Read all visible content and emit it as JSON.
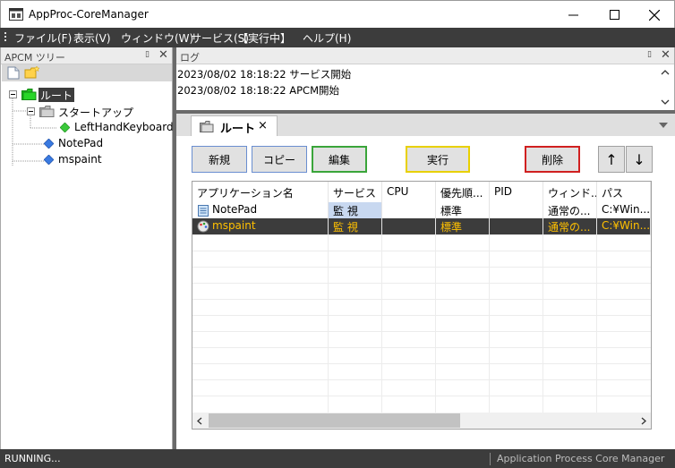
{
  "window": {
    "title": "AppProc-CoreManager",
    "minimize_glyph": "—",
    "maximize_glyph": "☐",
    "close_glyph": "✕"
  },
  "menu": {
    "items": [
      {
        "label": "ファイル(F)"
      },
      {
        "label": "表示(V)"
      },
      {
        "label": "ウィンドウ(W)"
      },
      {
        "label": "サービス(S)"
      },
      {
        "label": "【実行中】"
      },
      {
        "label": "ヘルプ(H)"
      }
    ]
  },
  "tree_panel": {
    "title": "APCM ツリー",
    "pin_glyph": "▯",
    "close_glyph": "✕",
    "nodes": [
      {
        "label": "ルート",
        "selected": true
      },
      {
        "label": "スタートアップ"
      },
      {
        "label": "LeftHandKeyboard"
      },
      {
        "label": "NotePad"
      },
      {
        "label": "mspaint"
      }
    ]
  },
  "log_panel": {
    "title": "ログ",
    "lines": [
      "2023/08/02 18:18:22 サービス開始",
      "2023/08/02 18:18:22 APCM開始"
    ]
  },
  "document": {
    "tab_label": "ルート",
    "tab_close": "×",
    "buttons": {
      "new": "新規",
      "copy": "コピー",
      "edit": "編集",
      "run": "実行",
      "delete": "削除",
      "up": "↑",
      "down": "↓"
    },
    "grid": {
      "columns": [
        "アプリケーション名",
        "サービス",
        "CPU",
        "優先順...",
        "PID",
        "ウィンド...",
        "パス"
      ],
      "rows": [
        {
          "name": "NotePad",
          "service": "監 視",
          "cpu": "",
          "priority": "標準",
          "pid": "",
          "window": "通常の...",
          "path": "C:¥Win..."
        },
        {
          "name": "mspaint",
          "service": "監 視",
          "cpu": "",
          "priority": "標準",
          "pid": "",
          "window": "通常の...",
          "path": "C:¥Win..."
        }
      ]
    }
  },
  "status": {
    "left": "RUNNING...",
    "right": "Application Process Core Manager"
  },
  "colors": {
    "menubar_bg": "#3c3c3c",
    "selected_row_bg": "#3c3c3c",
    "selected_row_text": "#ffc000",
    "service_cell_bg": "#c8d8f0",
    "edit_border": "#3aa53a",
    "run_border": "#e8d000",
    "delete_border": "#d02020",
    "new_border": "#6a8ed0"
  }
}
